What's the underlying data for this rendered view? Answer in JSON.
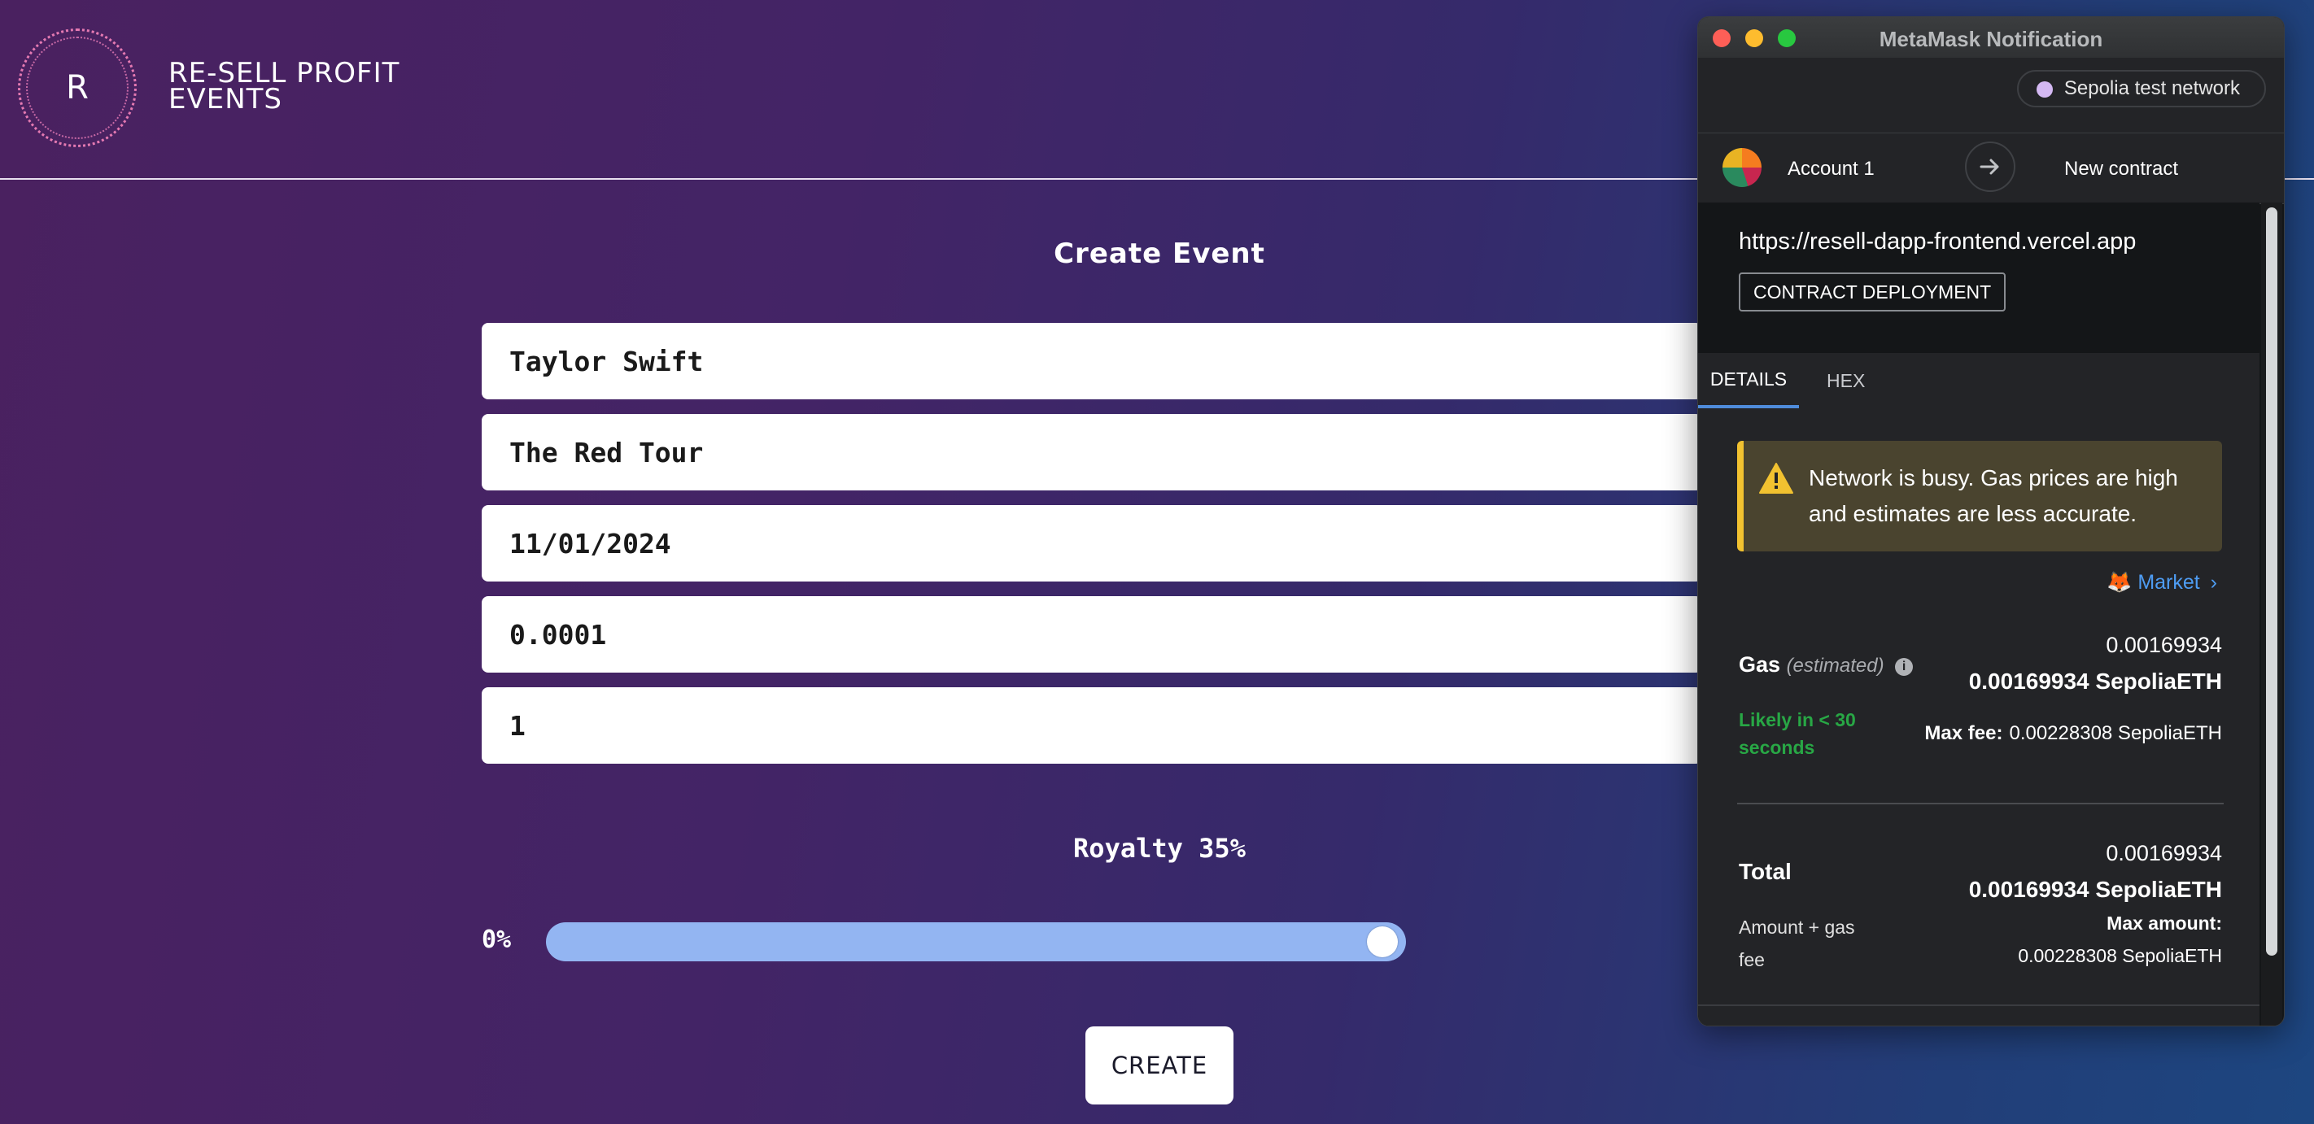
{
  "app": {
    "logo_letter": "R",
    "brand_line1": "RE-SELL PROFIT",
    "brand_line2": "EVENTS",
    "page_title": "Create Event",
    "fields": {
      "artist": "Taylor Swift",
      "event_name": "The Red Tour",
      "date": "11/01/2024",
      "price": "0.0001",
      "quantity": "1"
    },
    "royalty_label": "Royalty 35%",
    "royalty_value_percent": 35,
    "slider_min_label": "0%",
    "create_label": "CREATE"
  },
  "metamask": {
    "window_title": "MetaMask Notification",
    "network": "Sepolia test network",
    "account": "Account 1",
    "recipient": "New contract",
    "origin": "https://resell-dapp-frontend.vercel.app",
    "badge": "CONTRACT DEPLOYMENT",
    "tabs": [
      {
        "label": "DETAILS",
        "active": true
      },
      {
        "label": "HEX",
        "active": false
      }
    ],
    "warning": "Network is busy. Gas prices are high and estimates are less accurate.",
    "market_link": "Market",
    "gas": {
      "label": "Gas",
      "estimated": "(estimated)",
      "amount": "0.00169934",
      "amount_with_unit": "0.00169934 SepoliaETH",
      "likely": "Likely in < 30 seconds",
      "max_fee_label": "Max fee:",
      "max_fee_value": "0.00228308 SepoliaETH"
    },
    "total": {
      "label": "Total",
      "amount": "0.00169934",
      "amount_with_unit": "0.00169934 SepoliaETH",
      "sub_label": "Amount + gas fee",
      "max_amount_label": "Max amount:",
      "max_amount_value": "0.00228308 SepoliaETH"
    }
  },
  "colors": {
    "slider_fill": "#93b5f2",
    "mm_accent": "#4f8cdb",
    "warning_bar": "#f2c230",
    "success_green": "#28a745"
  },
  "icons": {
    "warning": "warning-triangle-icon",
    "market": "fox-icon",
    "info": "info-icon",
    "arrow": "arrow-right-icon"
  }
}
